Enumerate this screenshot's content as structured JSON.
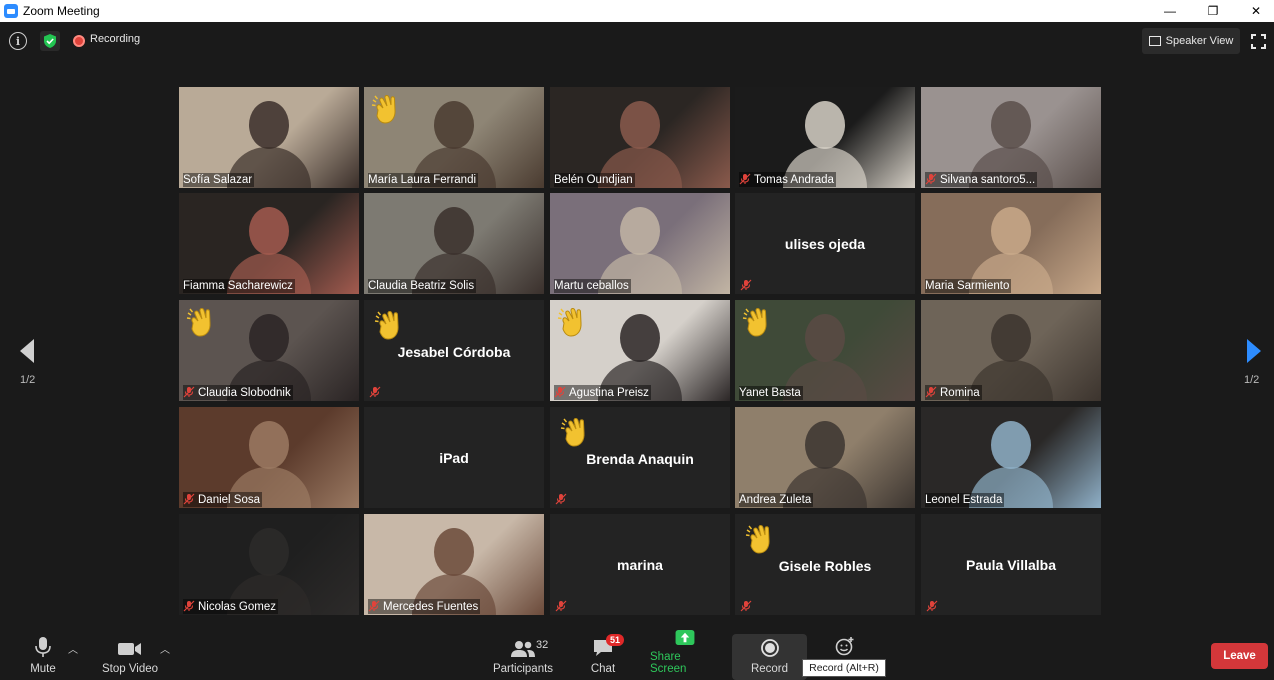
{
  "window": {
    "title": "Zoom Meeting",
    "minimize": "—",
    "restore": "❐",
    "close": "✕"
  },
  "topbar": {
    "recording_label": "Recording",
    "view_label": "Speaker View"
  },
  "pager": {
    "left_page": "1/2",
    "right_page": "1/2"
  },
  "tiles": [
    {
      "name": "Sofía Salazar",
      "video": true,
      "muted": false,
      "hand": false
    },
    {
      "name": "María Laura Ferrandi",
      "video": true,
      "muted": false,
      "hand": true,
      "active": true
    },
    {
      "name": "Belén Oundjian",
      "video": true,
      "muted": false,
      "hand": false
    },
    {
      "name": "Tomas Andrada",
      "video": true,
      "muted": true,
      "hand": false
    },
    {
      "name": "Silvana santoro5...",
      "video": true,
      "muted": true,
      "hand": false
    },
    {
      "name": "Fiamma Sacharewicz",
      "video": true,
      "muted": false,
      "hand": false
    },
    {
      "name": "Claudia Beatriz Solis",
      "video": true,
      "muted": false,
      "hand": false
    },
    {
      "name": "Martu ceballos",
      "video": true,
      "muted": false,
      "hand": false
    },
    {
      "name": "ulises ojeda",
      "video": false,
      "muted": true,
      "hand": false
    },
    {
      "name": "Maria Sarmiento",
      "video": true,
      "muted": false,
      "hand": false
    },
    {
      "name": "Claudia Slobodnik",
      "video": true,
      "muted": true,
      "hand": true
    },
    {
      "name": "Jesabel Córdoba",
      "video": false,
      "muted": true,
      "hand": true
    },
    {
      "name": "Agustina Preisz",
      "video": true,
      "muted": true,
      "hand": true
    },
    {
      "name": "Yanet Basta",
      "video": true,
      "muted": false,
      "hand": true
    },
    {
      "name": "Romina",
      "video": true,
      "muted": true,
      "hand": false
    },
    {
      "name": "Daniel Sosa",
      "video": true,
      "muted": true,
      "hand": false
    },
    {
      "name": "iPad",
      "video": false,
      "muted": false,
      "hand": false
    },
    {
      "name": "Brenda Anaquin",
      "video": false,
      "muted": true,
      "hand": true
    },
    {
      "name": "Andrea Zuleta",
      "video": true,
      "muted": false,
      "hand": false
    },
    {
      "name": "Leonel Estrada",
      "video": true,
      "muted": false,
      "hand": false
    },
    {
      "name": "Nicolas Gomez",
      "video": true,
      "muted": true,
      "hand": false
    },
    {
      "name": "Mercedes Fuentes",
      "video": true,
      "muted": true,
      "hand": false
    },
    {
      "name": "marina",
      "video": false,
      "muted": true,
      "hand": false
    },
    {
      "name": "Gisele Robles",
      "video": false,
      "muted": true,
      "hand": true
    },
    {
      "name": "Paula Villalba",
      "video": false,
      "muted": true,
      "hand": false
    }
  ],
  "toolbar": {
    "mute_label": "Mute",
    "stop_video_label": "Stop Video",
    "participants_label": "Participants",
    "participants_count": "32",
    "chat_label": "Chat",
    "chat_badge": "51",
    "share_label": "Share Screen",
    "record_label": "Record",
    "record_tooltip": "Record (Alt+R)",
    "leave_label": "Leave"
  },
  "colors": {
    "accent": "#2d8cff",
    "share_green": "#2ec75b",
    "leave_red": "#d3373a",
    "active_speaker": "#c9e265",
    "muted_red": "#e0433b",
    "hand_yellow": "#f2c230"
  }
}
